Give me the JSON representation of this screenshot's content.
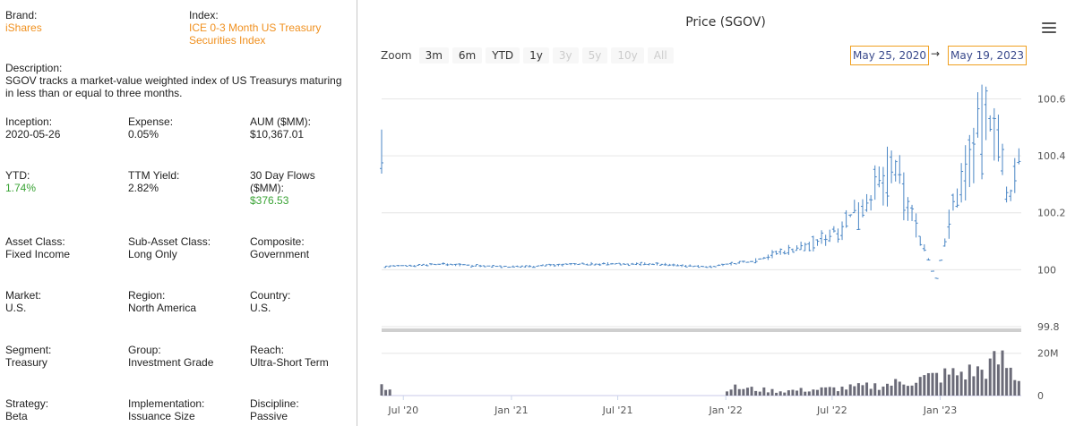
{
  "info": {
    "brand": {
      "label": "Brand:",
      "value": "iShares"
    },
    "index": {
      "label": "Index:",
      "value": "ICE 0-3 Month US Treasury Securities Index"
    },
    "description": {
      "label": "Description:",
      "value": "SGOV tracks a market-value weighted index of US Treasurys maturing in less than or equal to three months."
    },
    "inception": {
      "label": "Inception:",
      "value": "2020-05-26"
    },
    "expense": {
      "label": "Expense:",
      "value": "0.05%"
    },
    "aum": {
      "label": "AUM ($MM):",
      "value": "$10,367.01"
    },
    "ytd": {
      "label": "YTD:",
      "value": "1.74%"
    },
    "ttm_yield": {
      "label": "TTM Yield:",
      "value": "2.82%"
    },
    "flows": {
      "label": "30 Day Flows ($MM):",
      "value": "$376.53"
    },
    "asset_class": {
      "label": "Asset Class:",
      "value": "Fixed Income"
    },
    "sub_asset_class": {
      "label": "Sub-Asset Class:",
      "value": "Long Only"
    },
    "composite": {
      "label": "Composite:",
      "value": "Government"
    },
    "market": {
      "label": "Market:",
      "value": "U.S."
    },
    "region": {
      "label": "Region:",
      "value": "North America"
    },
    "country": {
      "label": "Country:",
      "value": "U.S."
    },
    "segment": {
      "label": "Segment:",
      "value": "Treasury"
    },
    "group": {
      "label": "Group:",
      "value": "Investment Grade"
    },
    "reach": {
      "label": "Reach:",
      "value": "Ultra-Short Term"
    },
    "strategy": {
      "label": "Strategy:",
      "value": "Beta"
    },
    "implementation": {
      "label": "Implementation:",
      "value": "Issuance Size"
    },
    "discipline": {
      "label": "Discipline:",
      "value": "Passive"
    }
  },
  "colors": {
    "orange": "#f0901e",
    "green": "#3aa335",
    "ohlc": "#4a86c5",
    "volume": "#6b6b78"
  },
  "toolbar": {
    "zoom_label": "Zoom",
    "zoom_buttons": [
      "3m",
      "6m",
      "YTD",
      "1y",
      "3y",
      "5y",
      "10y",
      "All"
    ],
    "zoom_enabled": [
      true,
      true,
      true,
      true,
      false,
      false,
      false,
      false
    ],
    "from_date": "May 25, 2020",
    "arrow": "→",
    "to_date": "May 19, 2023",
    "menu_icon": "hamburger-menu-icon"
  },
  "chart_data": {
    "type": "ohlc",
    "title": "Price (SGOV)",
    "price_axis": {
      "ticks": [
        "100.6",
        "100.4",
        "100.2",
        "100",
        "99.8"
      ],
      "tick_values": [
        100.6,
        100.4,
        100.2,
        100.0,
        99.8
      ],
      "ylim": [
        99.8,
        100.68
      ]
    },
    "volume_axis": {
      "ticks": [
        "20M",
        "0"
      ],
      "tick_values": [
        20,
        0
      ],
      "ylim": [
        0,
        22
      ],
      "unit": "M"
    },
    "x_ticks": [
      "Jul '20",
      "Jan '21",
      "Jul '21",
      "Jan '22",
      "Jul '22",
      "Jan '23"
    ],
    "x_tick_dates": [
      "2020-07-01",
      "2021-01-01",
      "2021-07-01",
      "2022-01-01",
      "2022-07-01",
      "2023-01-01"
    ],
    "x_range": [
      "2020-05-25",
      "2023-05-19"
    ],
    "price_points": [
      [
        "2020-05-26",
        100.01
      ],
      [
        "2020-09-01",
        100.02
      ],
      [
        "2021-01-01",
        100.01
      ],
      [
        "2021-05-01",
        100.02
      ],
      [
        "2021-09-01",
        100.02
      ],
      [
        "2021-12-01",
        100.01
      ],
      [
        "2022-02-15",
        100.03
      ],
      [
        "2022-04-01",
        100.06
      ],
      [
        "2022-06-01",
        100.09
      ],
      [
        "2022-07-15",
        100.15
      ],
      [
        "2022-09-01",
        100.25
      ],
      [
        "2022-10-15",
        100.35
      ],
      [
        "2022-12-01",
        100.1
      ],
      [
        "2022-12-25",
        99.96
      ],
      [
        "2023-01-20",
        100.2
      ],
      [
        "2023-03-01",
        100.45
      ],
      [
        "2023-04-05",
        100.55
      ],
      [
        "2023-04-25",
        100.22
      ],
      [
        "2023-05-19",
        100.42
      ]
    ],
    "volume_points": [
      [
        "2020-05-28",
        4.5
      ],
      [
        "2020-07-01",
        0.2
      ],
      [
        "2021-01-01",
        0.3
      ],
      [
        "2021-07-01",
        0.2
      ],
      [
        "2022-01-10",
        4.5
      ],
      [
        "2022-04-01",
        2.5
      ],
      [
        "2022-07-15",
        4.0
      ],
      [
        "2022-10-01",
        6.0
      ],
      [
        "2023-01-01",
        11.0
      ],
      [
        "2023-03-15",
        14.0
      ],
      [
        "2023-04-15",
        20.0
      ],
      [
        "2023-05-19",
        7.0
      ]
    ]
  }
}
